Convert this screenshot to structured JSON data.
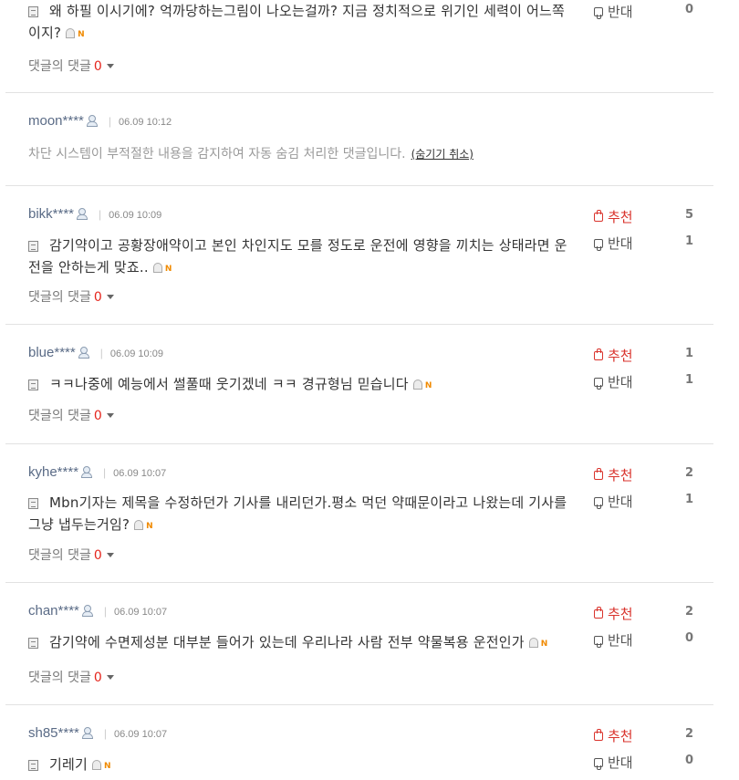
{
  "labels": {
    "recommend": "추천",
    "oppose": "반대",
    "reply": "댓글의 댓글",
    "new_badge": "N"
  },
  "comments": [
    {
      "text": "왜 하필 이시기에? 억까당하는그림이 나오는걸까? 지금 정치적으로 위기인 세력이 어느쪽이지?",
      "down": "0",
      "replies": "0"
    },
    {
      "user": "moon****",
      "date": "06.09 10:12",
      "blocked_text": "차단 시스템이 부적절한 내용을 감지하여 자동 숨김 처리한 댓글입니다.",
      "undo_text": "(숨기기 취소)"
    },
    {
      "user": "bikk****",
      "date": "06.09 10:09",
      "text": "감기약이고 공황장애약이고 본인 차인지도 모를 정도로 운전에 영향을 끼치는 상태라면 운전을 안하는게 맞죠..",
      "up": "5",
      "down": "1",
      "replies": "0"
    },
    {
      "user": "blue****",
      "date": "06.09 10:09",
      "text": "ㅋㅋ나중에 예능에서 썰풀때 웃기겠네 ㅋㅋ 경규형님 믿습니다",
      "up": "1",
      "down": "1",
      "replies": "0"
    },
    {
      "user": "kyhe****",
      "date": "06.09 10:07",
      "text": "Mbn기자는 제목을 수정하던가 기사를 내리던가.평소 먹던 약때문이라고 나왔는데 기사를 그냥 냅두는거임?",
      "up": "2",
      "down": "1",
      "replies": "0"
    },
    {
      "user": "chan****",
      "date": "06.09 10:07",
      "text": "감기약에 수면제성분 대부분 들어가 있는데 우리나라 사람 전부 약물복용 운전인가",
      "up": "2",
      "down": "0",
      "replies": "0"
    },
    {
      "user": "sh85****",
      "date": "06.09 10:07",
      "text": "기레기",
      "up": "2",
      "down": "0"
    }
  ]
}
